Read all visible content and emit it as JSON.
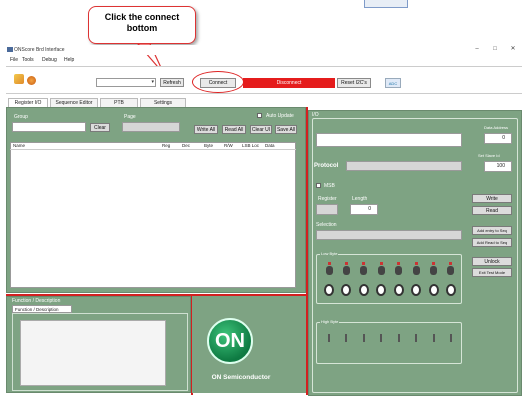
{
  "callout": {
    "text_line1": "Click the connect",
    "text_line2": "bottom"
  },
  "window": {
    "title": "ONScore Brd Interface",
    "minimize": "–",
    "maximize": "□",
    "close": "✕"
  },
  "menu": [
    "File",
    "Tools",
    "Debug",
    "Help"
  ],
  "toolbar": {
    "combo_value": "",
    "refresh_label": "Refresh",
    "connect_label": "Connect",
    "status_text": "Disconnect",
    "reset_label": "Reset I2C's",
    "ok_label": "ADC"
  },
  "tabs": [
    "Register I/O",
    "Sequence Editor",
    "PTB",
    "Settings"
  ],
  "left": {
    "group_label": "Group",
    "page_label": "Page",
    "clear_label": "Clear",
    "auto_update_label": "Auto Update",
    "buttons": [
      "Write All",
      "Read All",
      "Clear UI",
      "Save All"
    ],
    "columns": [
      "Name",
      "Reg",
      "Dec",
      "Byte",
      "R/W",
      "LSB Loc",
      "Data"
    ]
  },
  "function": {
    "title": "Function / Description",
    "tab": "Function / Description"
  },
  "logo": {
    "mark": "ON",
    "name": "ON Semiconductor"
  },
  "right": {
    "section_label": "I/O",
    "data_address_label": "Data Address",
    "data_address_value": "0",
    "protocol_label": "Protocol",
    "set_slave_label": "Set Slave Id",
    "set_slave_value": "100",
    "msb_label": "MSB",
    "register_label": "Register",
    "length_label": "Length",
    "length_value": "0",
    "selection_label": "Selection",
    "write_label": "Write",
    "read_label": "Read",
    "add_entry_label": "Add entry to Seq",
    "add_read_label": "Add Read to Seq",
    "unlock_label": "Unlock",
    "exit_test_label": "Exit Test Mode",
    "low_byte_label": "Low Byte",
    "high_byte_label": "High Byte"
  }
}
